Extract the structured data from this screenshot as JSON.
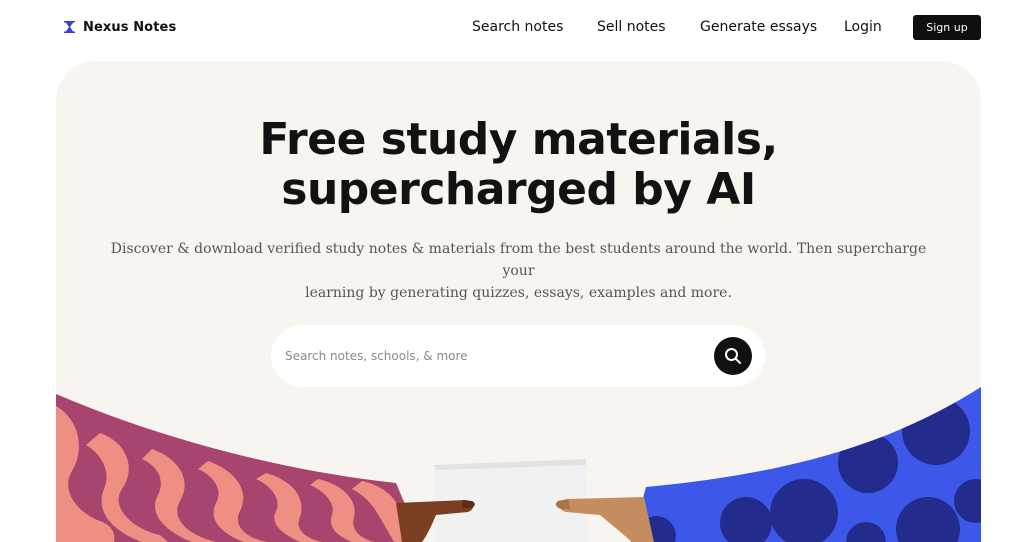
{
  "header": {
    "brand": "Nexus Notes",
    "brand_icon": "hourglass-logo-icon",
    "nav": {
      "search_notes": "Search notes",
      "sell_notes": "Sell notes",
      "generate_essays": "Generate essays",
      "login": "Login",
      "signup": "Sign up"
    }
  },
  "hero": {
    "title_line1": "Free study materials,",
    "title_line2": "supercharged by AI",
    "subtitle_line1": "Discover & download verified study notes & materials from the best students around the world. Then supercharge your",
    "subtitle_line2": "learning by generating quizzes, essays, examples and more.",
    "search": {
      "placeholder": "Search notes, schools, & more",
      "value": "",
      "button_icon": "search-icon"
    }
  },
  "colors": {
    "brand_accent": "#3b3fe0",
    "hero_background": "#f8f5f0",
    "button_dark": "#0f0f10",
    "left_sleeve_base": "#a8456e",
    "left_sleeve_pattern": "#ef8f83",
    "right_sleeve_base": "#3d57e8",
    "right_sleeve_dots": "#232b8c",
    "left_hand_skin": "#7a3f22",
    "right_hand_skin": "#c58d5f",
    "paper": "#f1f1f1"
  }
}
